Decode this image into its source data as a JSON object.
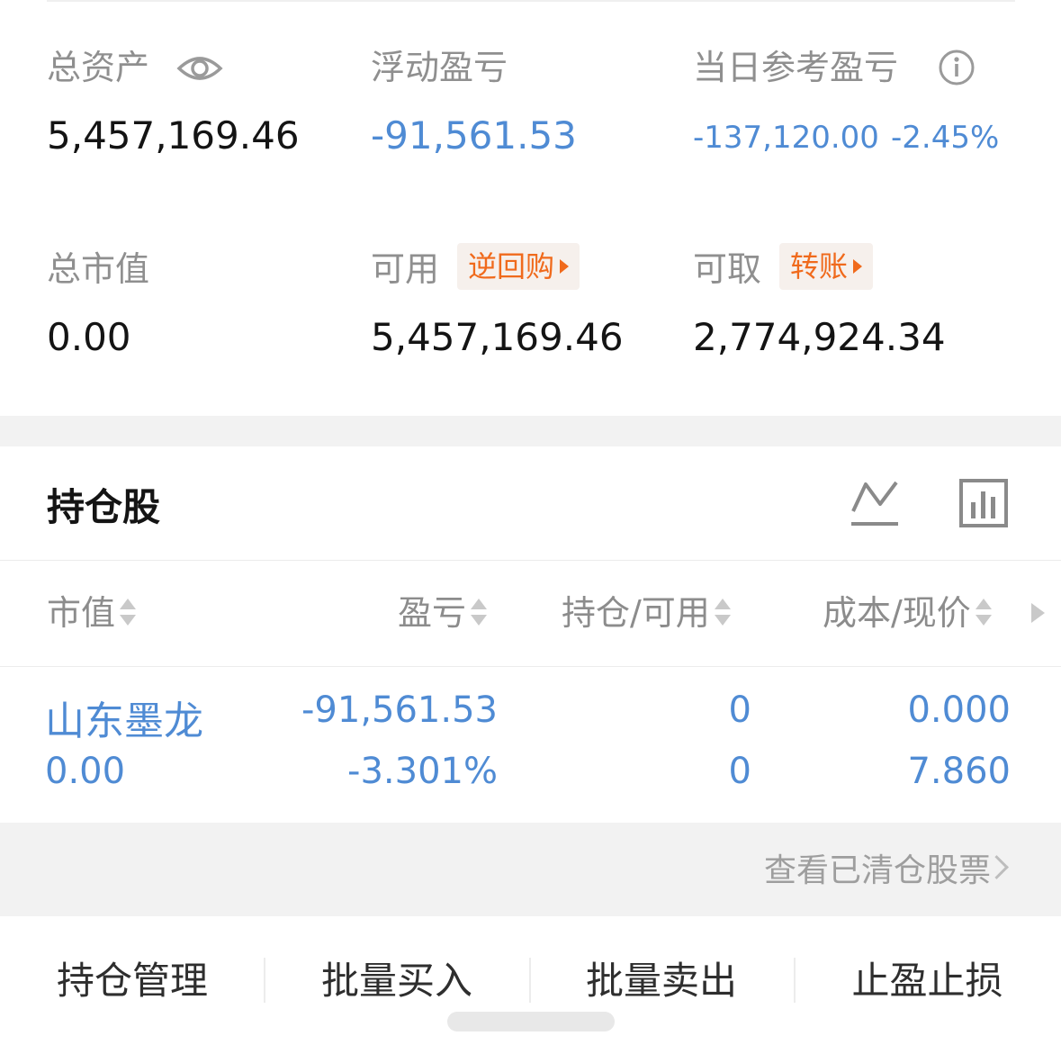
{
  "summary": {
    "total_assets_label": "总资产",
    "total_assets_value": "5,457,169.46",
    "floating_pnl_label": "浮动盈亏",
    "floating_pnl_value": "-91,561.53",
    "daily_pnl_label": "当日参考盈亏",
    "daily_pnl_value": "-137,120.00",
    "daily_pnl_pct": "-2.45%",
    "market_value_label": "总市值",
    "market_value_value": "0.00",
    "available_label": "可用",
    "available_tag": "逆回购",
    "available_value": "5,457,169.46",
    "withdrawable_label": "可取",
    "withdrawable_tag": "转账",
    "withdrawable_value": "2,774,924.34"
  },
  "holdings": {
    "title": "持仓股",
    "columns": [
      "市值",
      "盈亏",
      "持仓/可用",
      "成本/现价"
    ],
    "rows": [
      {
        "name": "山东墨龙",
        "market_value": "0.00",
        "pnl": "-91,561.53",
        "pnl_pct": "-3.301%",
        "position": "0",
        "available": "0",
        "cost": "0.000",
        "price": "7.860"
      }
    ],
    "view_cleared": "查看已清仓股票"
  },
  "actions": [
    "持仓管理",
    "批量买入",
    "批量卖出",
    "止盈止损"
  ],
  "colors": {
    "blue": "#4f8bd4",
    "orange": "#f06a1c"
  },
  "icons": [
    "eye-icon",
    "info-icon",
    "line-chart-icon",
    "bar-chart-icon"
  ]
}
